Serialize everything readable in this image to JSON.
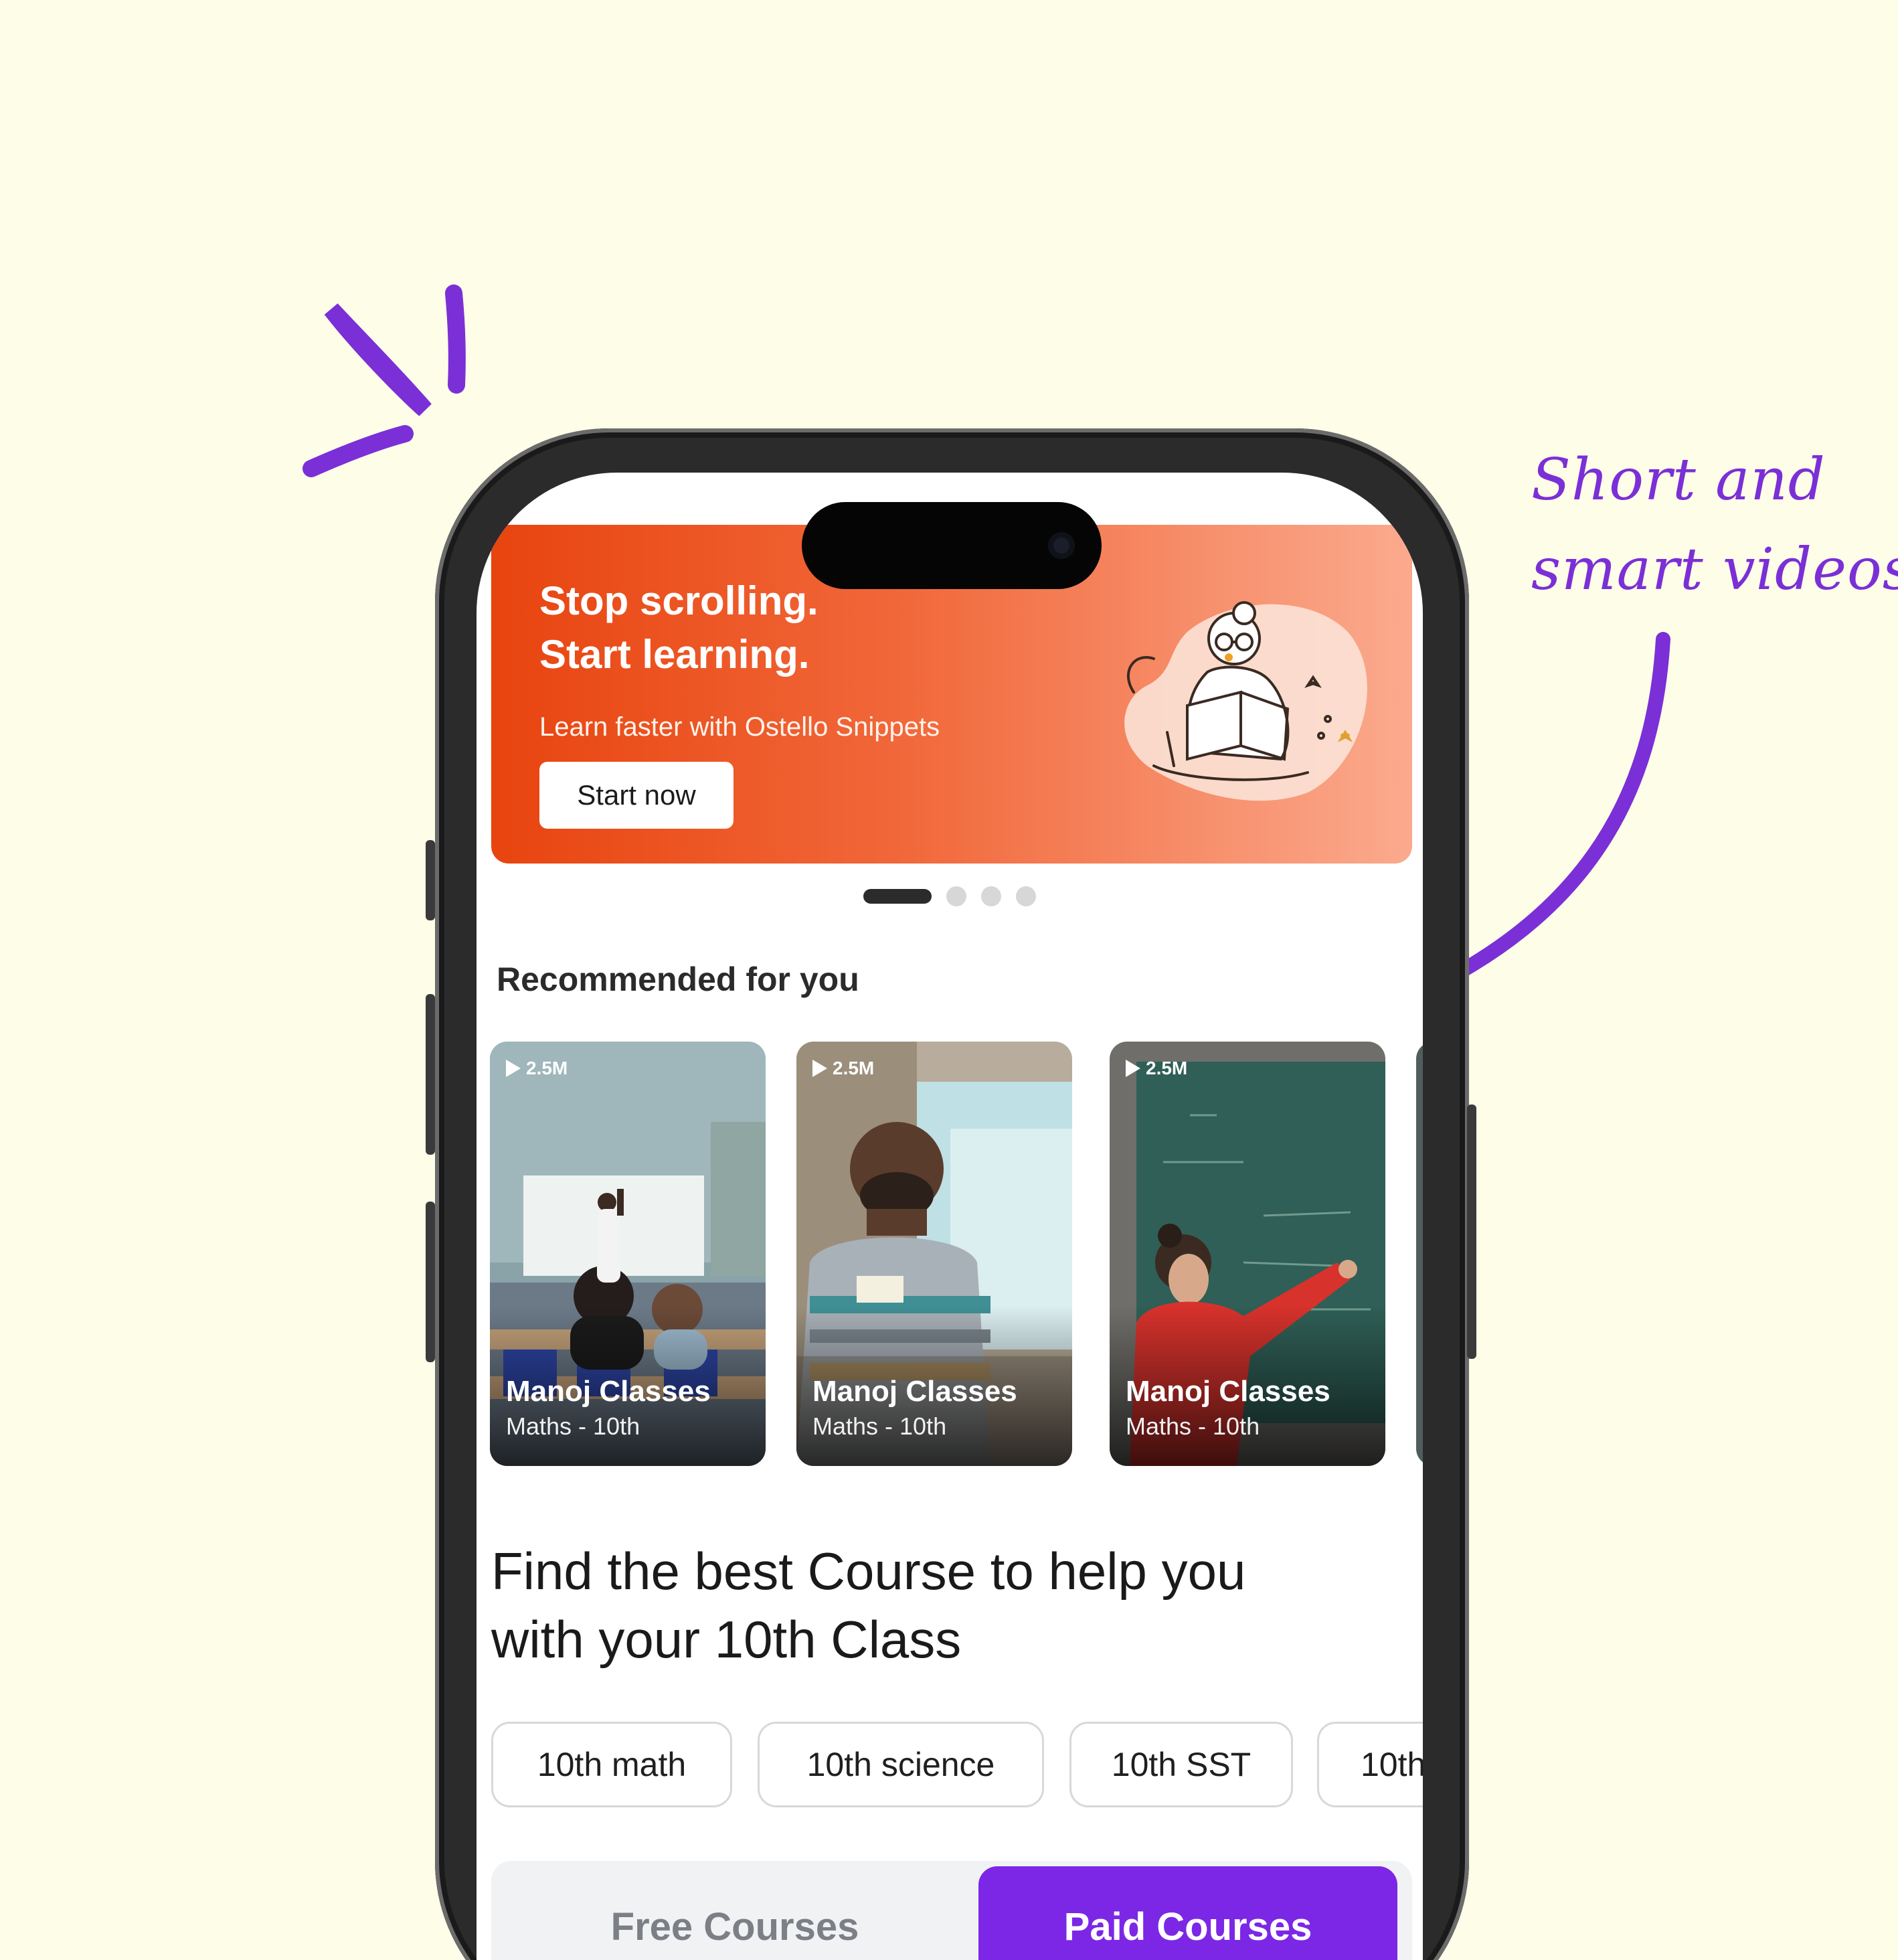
{
  "annotation": {
    "line1": "Short and",
    "line2": "smart videos"
  },
  "banner": {
    "title_line1": "Stop scrolling.",
    "title_line2": "Start learning.",
    "subtitle": "Learn faster with Ostello Snippets",
    "cta_label": "Start now",
    "illustration_icon": "reading-girl-illustration"
  },
  "carousel": {
    "total_pages": 4,
    "active_index": 0
  },
  "recommended": {
    "title": "Recommended for you",
    "reels": [
      {
        "views": "2.5M",
        "name": "Manoj Classes",
        "subject": "Maths - 10th"
      },
      {
        "views": "2.5M",
        "name": "Manoj Classes",
        "subject": "Maths - 10th"
      },
      {
        "views": "2.5M",
        "name": "Manoj Classes",
        "subject": "Maths - 10th"
      }
    ]
  },
  "courses": {
    "headline_line1": "Find the best Course to help you",
    "headline_line2": "with your 10th Class",
    "chips": [
      "10th math",
      "10th science",
      "10th SST",
      "10th"
    ],
    "tabs": {
      "free": "Free Courses",
      "paid": "Paid Courses",
      "active": "paid"
    }
  },
  "colors": {
    "background": "#fdfde8",
    "accent": "#7c27e6",
    "banner_start": "#e8440f",
    "banner_end": "#fbaa8e"
  }
}
